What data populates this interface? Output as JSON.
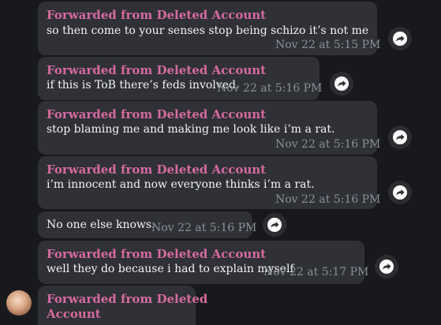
{
  "messages": [
    {
      "forwarded": "Forwarded from Deleted Account",
      "text": "so then come to your senses stop being schizo it’s not me",
      "time": "Nov 22 at 5:15 PM"
    },
    {
      "forwarded": "Forwarded from Deleted Account",
      "text": "if this is ToB there’s feds involved.",
      "time": "Nov 22 at 5:16 PM"
    },
    {
      "forwarded": "Forwarded from Deleted Account",
      "text": "stop blaming me and making me look like i’m a rat.",
      "time": "Nov 22 at 5:16 PM"
    },
    {
      "forwarded": "Forwarded from Deleted Account",
      "text": "i’m innocent and now everyone thinks i’m a rat.",
      "time": "Nov 22 at 5:16 PM"
    },
    {
      "forwarded": "",
      "text": "No one else knows.",
      "time": "Nov 22 at 5:16 PM"
    },
    {
      "forwarded": "Forwarded from Deleted Account",
      "text": "well they do because i had to explain myself",
      "time": "Nov 22 at 5:17 PM"
    },
    {
      "forwarded_line1": "Forwarded from Deleted",
      "forwarded_line2": "Account"
    }
  ],
  "icons": {
    "share": "share-arrow-icon",
    "avatar": "avatar"
  },
  "colors": {
    "background": "#18191d",
    "bubble": "#2f3136",
    "forward_label": "#d56aa0",
    "text": "#f2f3f5",
    "time": "#8c8f96",
    "share_button": "#2b2d31"
  }
}
